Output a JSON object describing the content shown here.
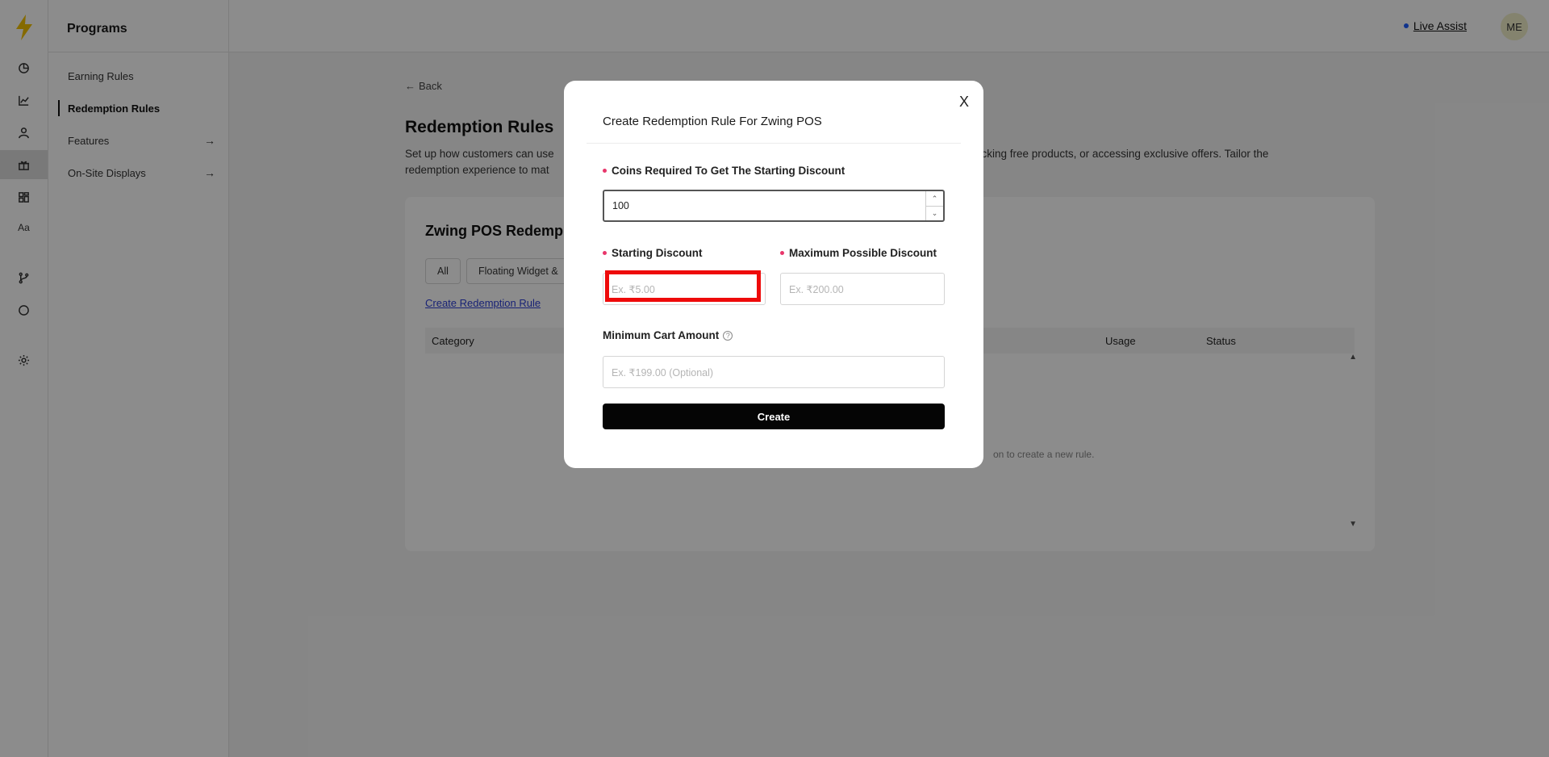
{
  "rail": {
    "icons": [
      "logo-bolt-icon",
      "dashboard-icon",
      "analytics-icon",
      "customers-icon",
      "programs-gift-icon",
      "widgets-icon",
      "branding-icon",
      "integrations-icon",
      "support-chat-icon",
      "settings-icon"
    ],
    "branding_label": "Aa"
  },
  "sidebar": {
    "title": "Programs",
    "items": [
      {
        "label": "Earning Rules"
      },
      {
        "label": "Redemption Rules"
      },
      {
        "label": "Features"
      },
      {
        "label": "On-Site Displays"
      }
    ]
  },
  "header": {
    "live_assist": "Live Assist",
    "avatar_initials": "ME"
  },
  "page": {
    "back": "Back",
    "title": "Redemption Rules",
    "desc_left_1": "Set up how customers can use",
    "desc_right_1": "ocking free products, or accessing exclusive offers. Tailor the",
    "desc_left_2": "redemption experience to mat",
    "card_title": "Zwing POS Redemp",
    "filters": [
      "All",
      "Floating Widget &"
    ],
    "create_link": "Create Redemption Rule",
    "columns": {
      "category": "Category",
      "usage": "Usage",
      "status": "Status"
    },
    "empty_text": "on to create a new rule."
  },
  "modal": {
    "title": "Create Redemption Rule For Zwing POS",
    "close": "X",
    "coins_label": "Coins Required To Get The Starting Discount",
    "coins_value": "100",
    "starting_label": "Starting Discount",
    "starting_placeholder": "Ex. ₹5.00",
    "max_label": "Maximum Possible Discount",
    "max_placeholder": "Ex. ₹200.00",
    "min_cart_label": "Minimum Cart Amount",
    "min_cart_placeholder": "Ex. ₹199.00 (Optional)",
    "create_button": "Create"
  },
  "colors": {
    "required_dot": "#e8366b",
    "highlight": "#ee0a0a",
    "accent_link": "#2c3ed6",
    "button": "#050505"
  }
}
